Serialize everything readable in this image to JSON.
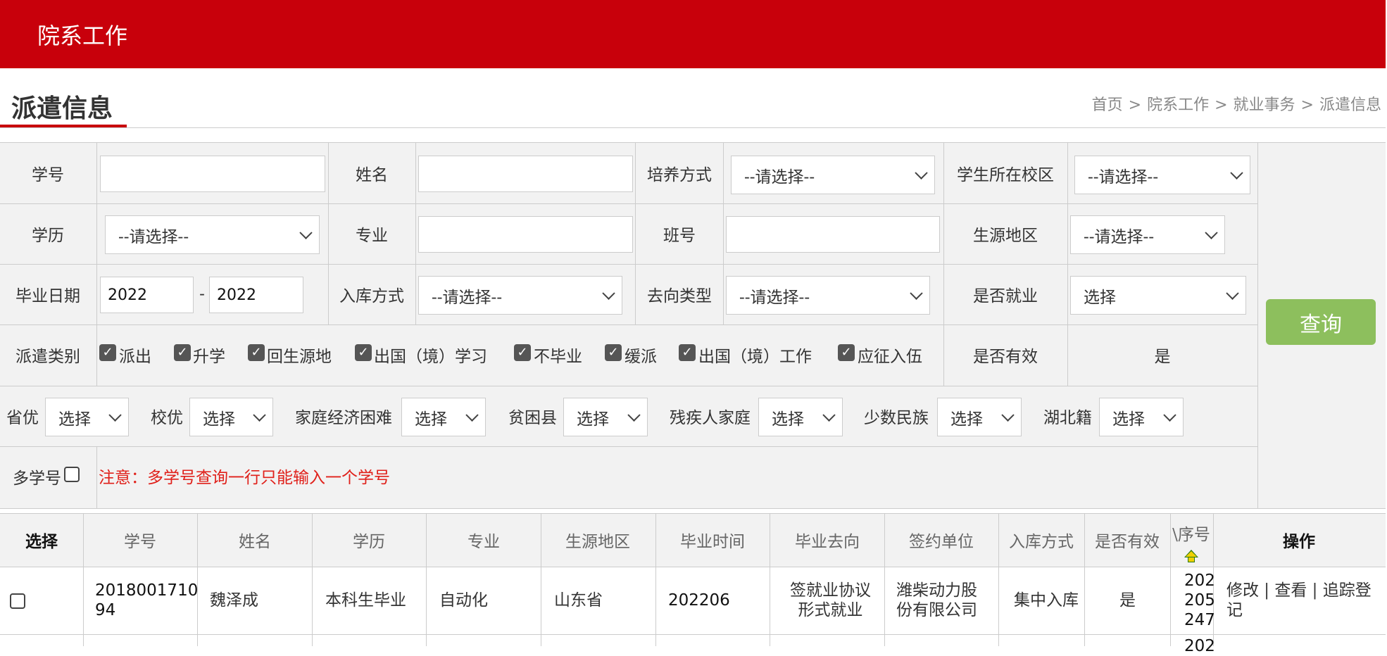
{
  "topbar": {
    "title": "院系工作"
  },
  "page": {
    "title": "派遣信息",
    "breadcrumb": [
      "首页",
      ">",
      "院系工作",
      ">",
      "就业事务",
      ">",
      "派遣信息"
    ]
  },
  "form": {
    "row1": {
      "student_id_label": "学号",
      "student_id_value": "",
      "name_label": "姓名",
      "name_value": "",
      "training_label": "培养方式",
      "training_value": "--请选择--",
      "campus_label": "学生所在校区",
      "campus_value": "--请选择--"
    },
    "row2": {
      "education_label": "学历",
      "education_value": "--请选择--",
      "major_label": "专业",
      "major_value": "",
      "class_label": "班号",
      "class_value": "",
      "origin_label": "生源地区",
      "origin_value": "--请选择--"
    },
    "row3": {
      "grad_date_label": "毕业日期",
      "grad_from": "2022",
      "dash": "-",
      "grad_to": "2022",
      "storage_label": "入库方式",
      "storage_value": "--请选择--",
      "dest_type_label": "去向类型",
      "dest_type_value": "--请选择--",
      "employed_label": "是否就业",
      "employed_value": "选择"
    },
    "row4": {
      "dispatch_label": "派遣类别",
      "dispatch_options": [
        "派出",
        "升学",
        "回生源地",
        "出国（境）学习",
        "不毕业",
        "缓派",
        "出国（境）工作",
        "应征入伍"
      ],
      "valid_label": "是否有效",
      "valid_value": "是"
    },
    "row5": {
      "filters": [
        {
          "label": "省优",
          "value": "选择"
        },
        {
          "label": "校优",
          "value": "选择"
        },
        {
          "label": "家庭经济困难",
          "value": "选择"
        },
        {
          "label": "贫困县",
          "value": "选择"
        },
        {
          "label": "残疾人家庭",
          "value": "选择"
        },
        {
          "label": "少数民族",
          "value": "选择"
        },
        {
          "label": "湖北籍",
          "value": "选择"
        }
      ]
    },
    "row6": {
      "multi_label": "多学号",
      "note": "注意：多学号查询一行只能输入一个学号"
    },
    "query_button": "查询"
  },
  "table": {
    "headers": [
      "选择",
      "学号",
      "姓名",
      "学历",
      "专业",
      "生源地区",
      "毕业时间",
      "毕业去向",
      "签约单位",
      "入库方式",
      "是否有效",
      "\\序号",
      "操作"
    ],
    "rows": [
      {
        "student_id": [
          "201800171094"
        ],
        "student_id_l1": "2018001710",
        "student_id_l2": "94",
        "name": "魏泽成",
        "education": "本科生毕业",
        "major": "自动化",
        "origin": "山东省",
        "grad_time": "202206",
        "destination_l1": "签就业协议",
        "destination_l2": "形式就业",
        "employer_l1": "潍柴动力股",
        "employer_l2": "份有限公司",
        "storage": "集中入库",
        "valid": "是",
        "seq_l1": "202",
        "seq_l2": "205",
        "seq_l3": "247",
        "actions_l1": "修改 | 查看 | 追踪登",
        "actions_l2": "记"
      }
    ],
    "next_row_seq_partial": "202"
  }
}
